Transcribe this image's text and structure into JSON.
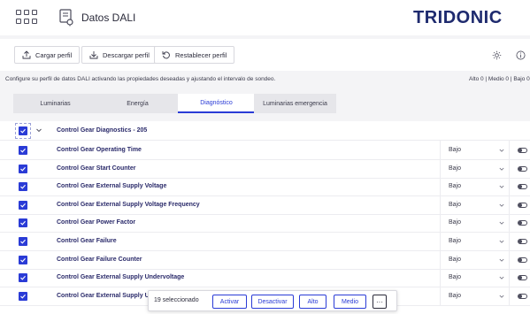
{
  "header": {
    "app_title": "Datos DALI",
    "brand": "TRIDONIC",
    "menu_icon": "grid-icon",
    "app_icon": "dali-document-icon"
  },
  "toolbar": {
    "load_label": "Cargar perfil",
    "download_label": "Descargar perfil",
    "reset_label": "Restablecer perfil",
    "settings_icon": "gear-icon",
    "info_icon": "info-icon"
  },
  "description": "Configure su perfil de datos DALI activando las propiedades deseadas y ajustando el intervalo de sondeo.",
  "levels_summary": "Alto 0 | Medio 0 | Bajo 0",
  "tabs": [
    {
      "label": "Luminarias"
    },
    {
      "label": "Energía"
    },
    {
      "label": "Diagnóstico"
    },
    {
      "label": "Luminarias emergencia"
    }
  ],
  "active_tab": "Diagnóstico",
  "group": {
    "name": "Control Gear Diagnostics - 205",
    "checked": true
  },
  "rows": [
    {
      "name": "Control Gear Operating Time",
      "interval": "Bajo",
      "checked": true,
      "enabled": false
    },
    {
      "name": "Control Gear Start Counter",
      "interval": "Bajo",
      "checked": true,
      "enabled": false
    },
    {
      "name": "Control Gear External Supply Voltage",
      "interval": "Bajo",
      "checked": true,
      "enabled": false
    },
    {
      "name": "Control Gear External Supply Voltage Frequency",
      "interval": "Bajo",
      "checked": true,
      "enabled": false
    },
    {
      "name": "Control Gear Power Factor",
      "interval": "Bajo",
      "checked": true,
      "enabled": false
    },
    {
      "name": "Control Gear Failure",
      "interval": "Bajo",
      "checked": true,
      "enabled": false
    },
    {
      "name": "Control Gear Failure Counter",
      "interval": "Bajo",
      "checked": true,
      "enabled": false
    },
    {
      "name": "Control Gear External Supply Undervoltage",
      "interval": "Bajo",
      "checked": true,
      "enabled": false
    },
    {
      "name": "Control Gear External Supply Underve",
      "interval": "Bajo",
      "checked": true,
      "enabled": false
    }
  ],
  "action_bar": {
    "selected_count": "19 seleccionado",
    "activate_label": "Activar",
    "deactivate_label": "Desactivar",
    "high_label": "Alto",
    "medium_label": "Medio",
    "more_label": "···"
  },
  "colors": {
    "accent": "#2a3bd6",
    "brand": "#1e2a6e",
    "background": "#f4f4f6"
  }
}
